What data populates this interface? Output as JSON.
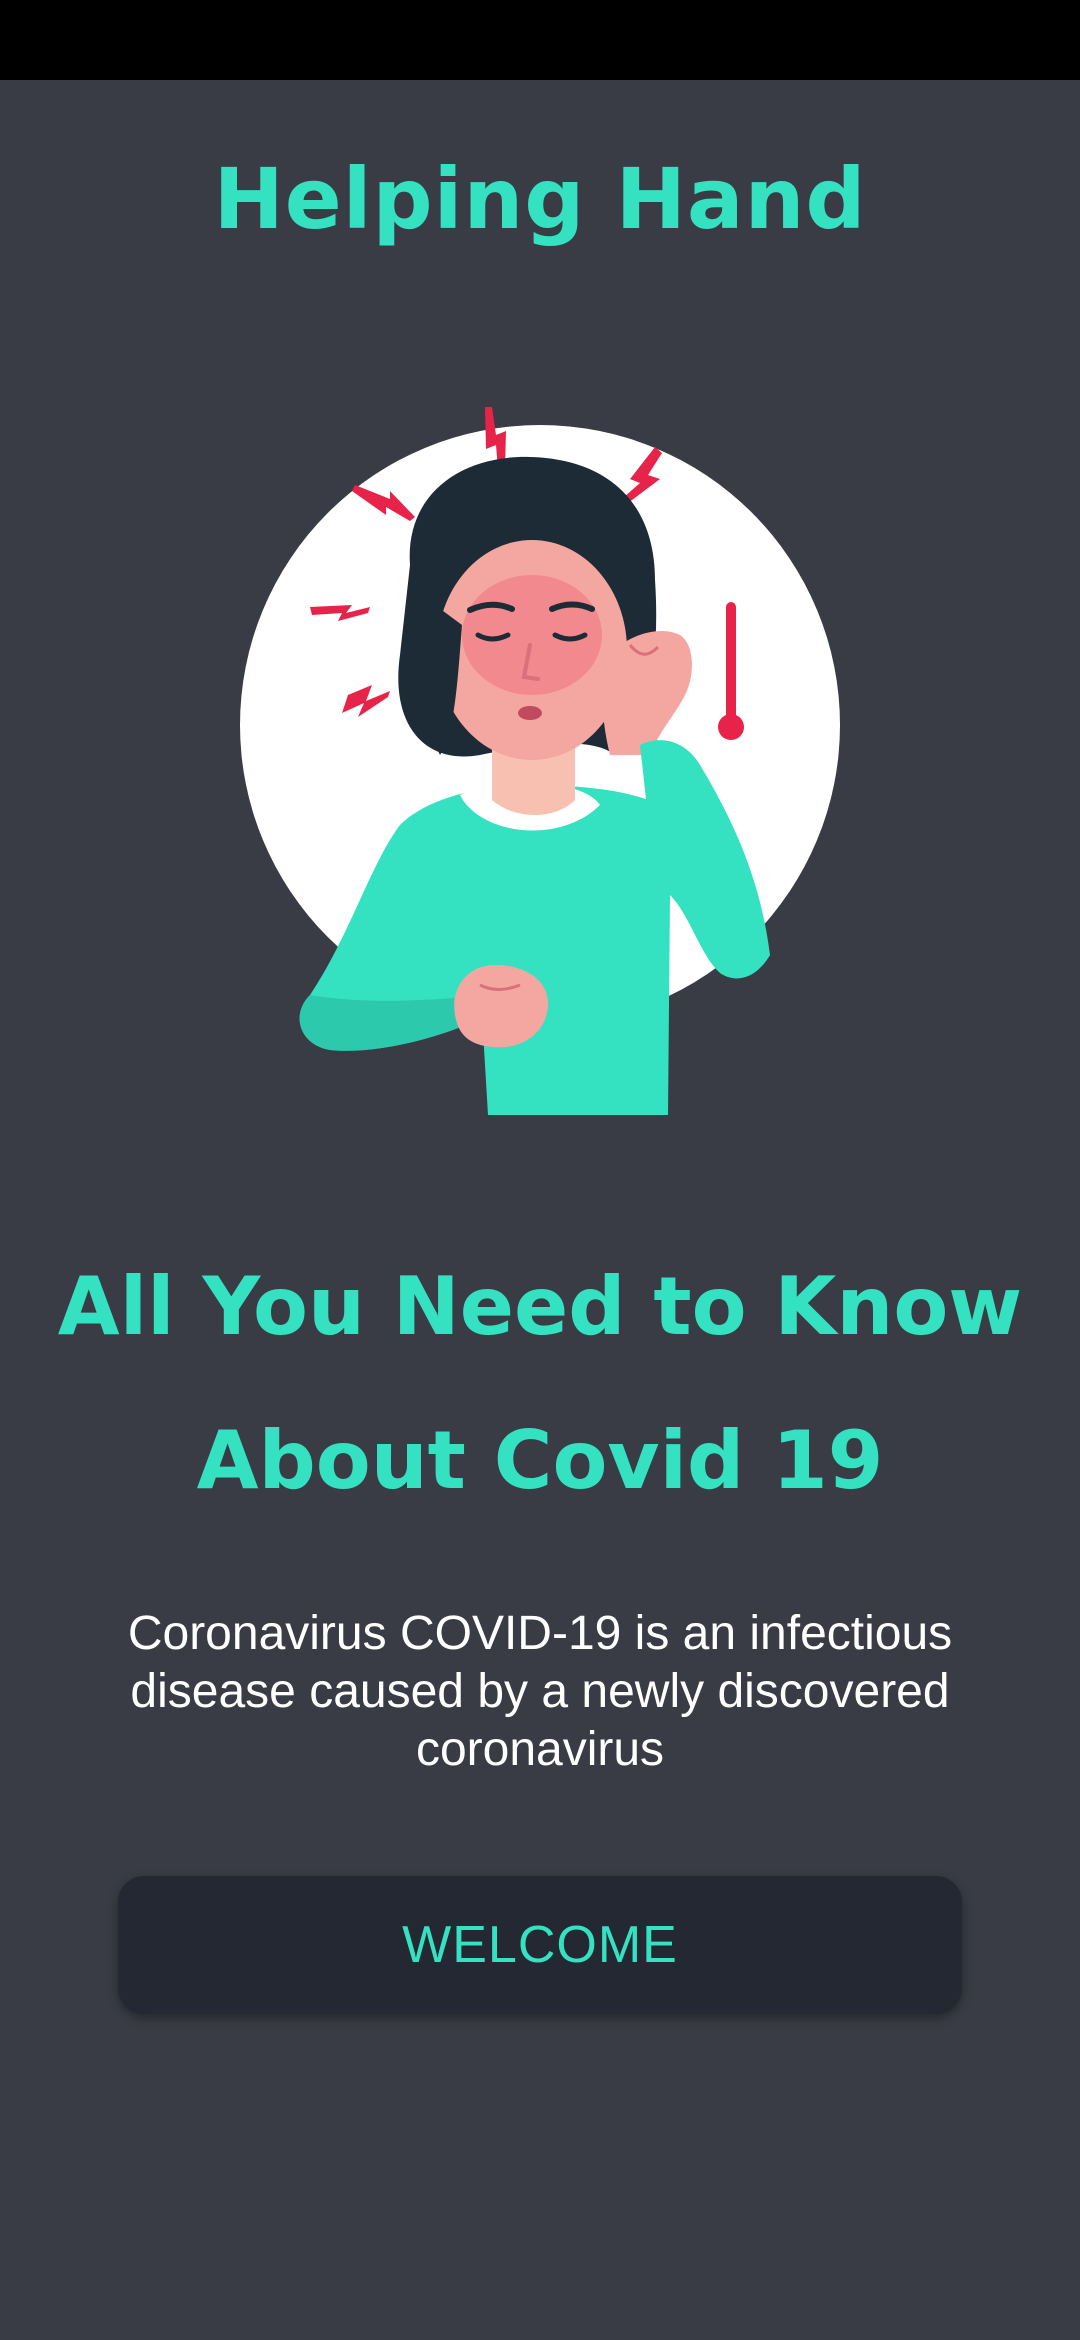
{
  "app": {
    "title": "Helping Hand"
  },
  "hero": {
    "illustration_icon": "sick-woman-fever-illustration"
  },
  "headline": {
    "line1": "All You Need to Know",
    "line2": "About Covid 19"
  },
  "description": {
    "text": "Coronavirus COVID-19 is an infectious disease caused by a newly discovered coronavirus"
  },
  "actions": {
    "welcome_label": "WELCOME"
  },
  "colors": {
    "background": "#393c45",
    "accent": "#34e1c1",
    "button_background": "#232832",
    "alert_red": "#e8234a"
  }
}
